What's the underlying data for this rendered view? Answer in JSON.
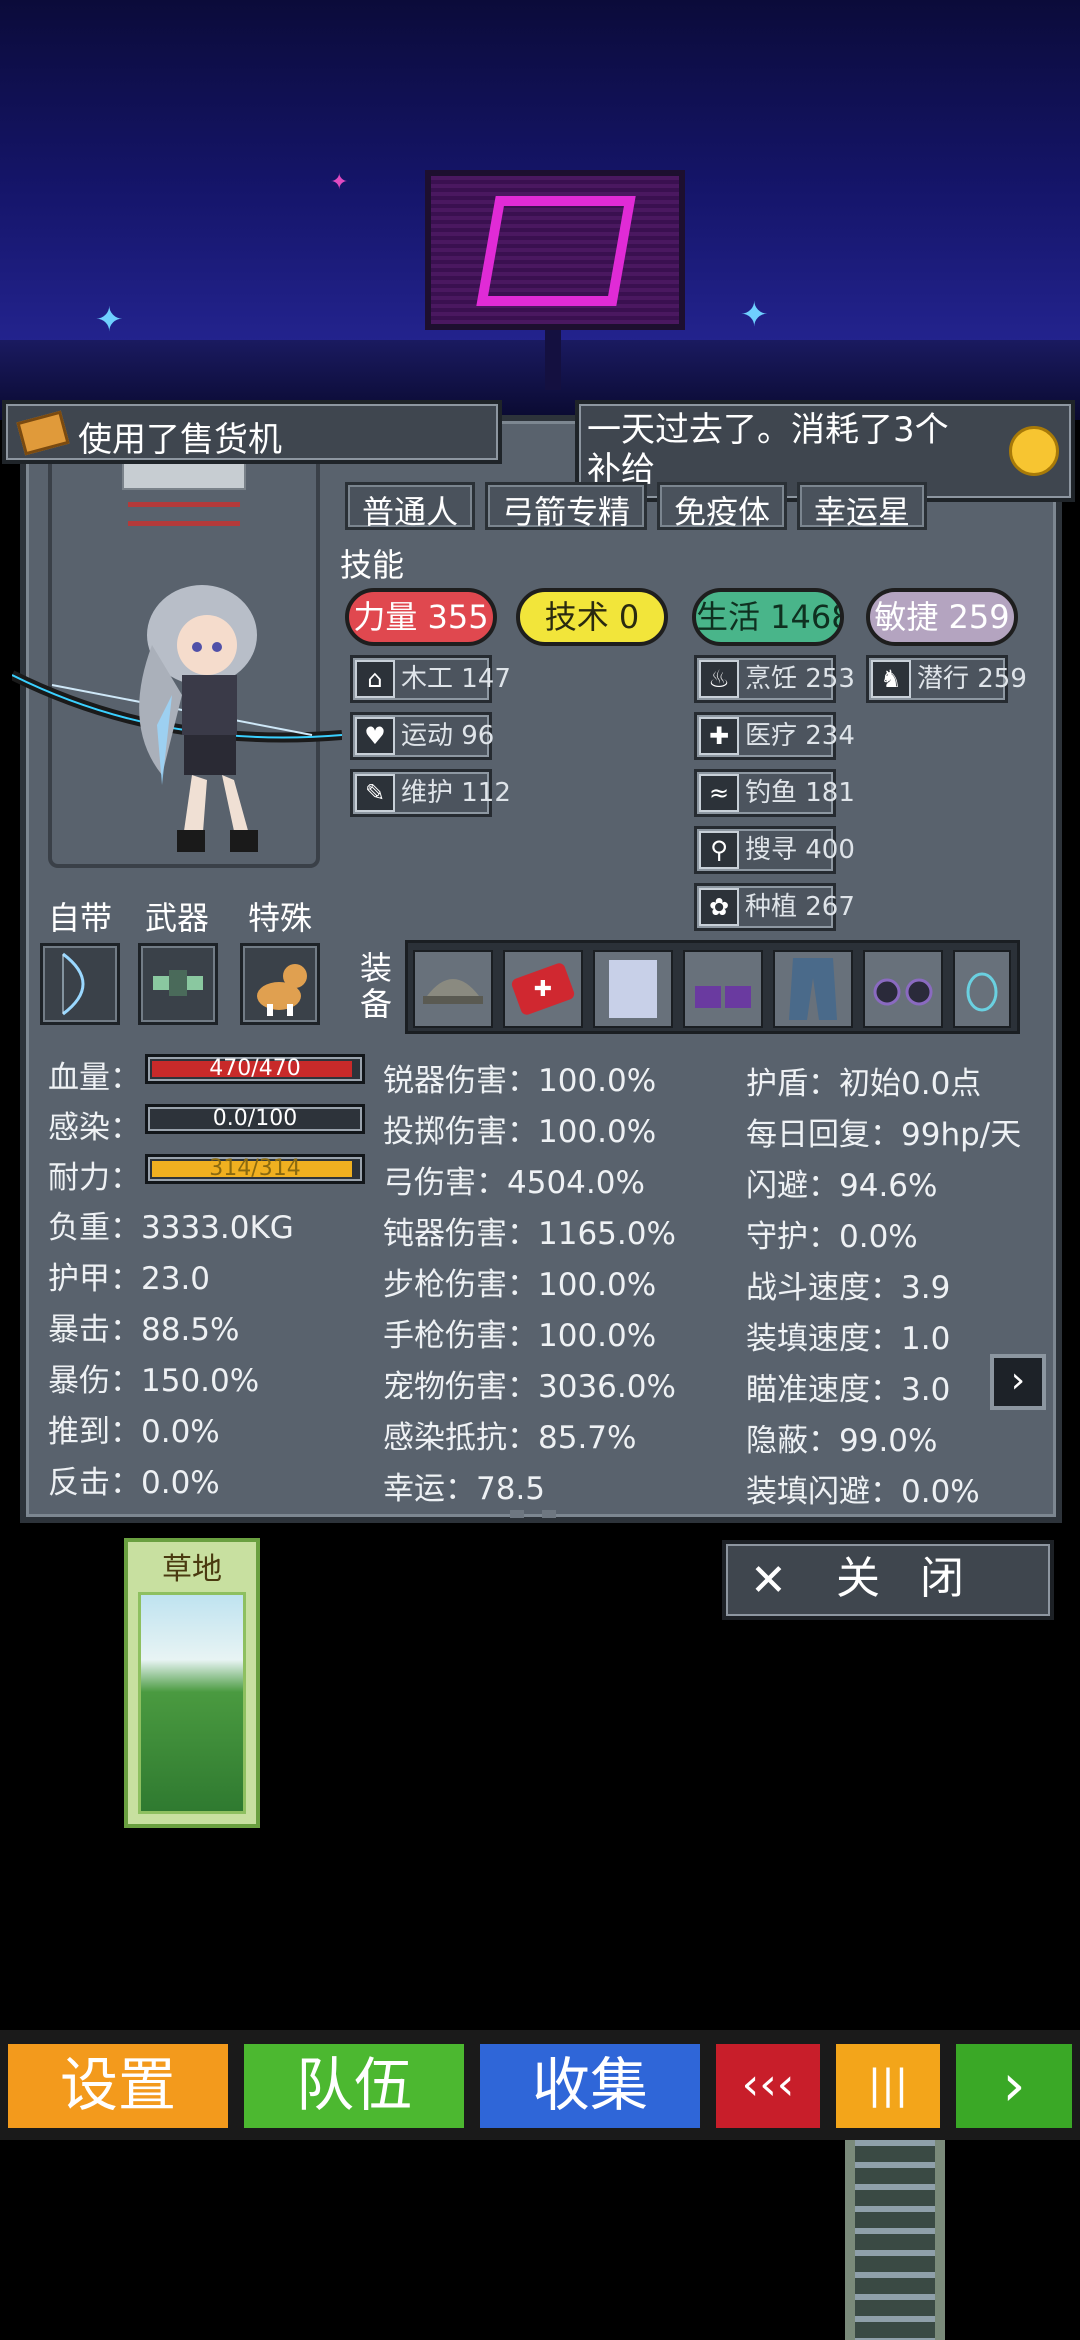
{
  "notifications": {
    "left": "使用了售货机",
    "right": "一天过去了。消耗了3个补给"
  },
  "tags": [
    "普通人",
    "弓箭专精",
    "免疫体",
    "幸运星"
  ],
  "skills_title": "技能",
  "skill_pills": [
    {
      "label": "力量 355",
      "color": "#e0484f"
    },
    {
      "label": "技术 0",
      "color": "#f2e53a"
    },
    {
      "label": "生活 1468",
      "color": "#49b58a"
    },
    {
      "label": "敏捷 259",
      "color": "#b4a4c0"
    }
  ],
  "sub_skills": [
    {
      "label": "木工 147",
      "icon": "house-icon"
    },
    {
      "label": "运动 96",
      "icon": "heart-icon"
    },
    {
      "label": "维护 112",
      "icon": "wrench-icon"
    },
    {
      "label": "烹饪 253",
      "icon": "pot-icon"
    },
    {
      "label": "医疗 234",
      "icon": "medkit-icon"
    },
    {
      "label": "钓鱼 181",
      "icon": "fish-icon"
    },
    {
      "label": "搜寻 400",
      "icon": "magnifier-icon"
    },
    {
      "label": "种植 267",
      "icon": "plant-icon"
    },
    {
      "label": "潜行 259",
      "icon": "sneak-icon"
    }
  ],
  "categories": {
    "innate": "自带",
    "weapon": "武器",
    "special": "特殊"
  },
  "equip_label": "装备",
  "stats_col1": {
    "hp_label": "血量：",
    "hp_value": "470/470",
    "hp_fraction": 1.0,
    "infection_label": "感染：",
    "infection_value": "0.0/100",
    "infection_fraction": 0.0,
    "stamina_label": "耐力：",
    "stamina_value": "314/314",
    "stamina_fraction": 1.0,
    "rows": [
      "负重：3333.0KG",
      "护甲：23.0",
      "暴击：88.5%",
      "暴伤：150.0%",
      "推到：0.0%",
      "反击：0.0%"
    ]
  },
  "stats_col2": [
    "锐器伤害：100.0%",
    "投掷伤害：100.0%",
    "弓伤害：4504.0%",
    "钝器伤害：1165.0%",
    "步枪伤害：100.0%",
    "手枪伤害：100.0%",
    "宠物伤害：3036.0%",
    "感染抵抗：85.7%",
    "幸运：78.5"
  ],
  "stats_col3": [
    "护盾：初始0.0点",
    "每日回复：99hp/天",
    "闪避：94.6%",
    "守护：0.0%",
    "战斗速度：3.9",
    "装填速度：1.0",
    "瞄准速度：3.0",
    "隐蔽：99.0%",
    "装填闪避：0.0%"
  ],
  "close_button": {
    "icon": "✕",
    "label": "关闭"
  },
  "location_card": {
    "title": "草地"
  },
  "bottom_nav": {
    "settings": "设置",
    "team": "队伍",
    "collect": "收集",
    "rewind": "‹‹‹",
    "pause": "|||",
    "play": "›"
  },
  "colors": {
    "settings": "#f39a1c",
    "team": "#4cb830",
    "collect": "#2f66d8",
    "rewind": "#c81e2a",
    "pause": "#f3a51a",
    "play": "#3aa826"
  }
}
